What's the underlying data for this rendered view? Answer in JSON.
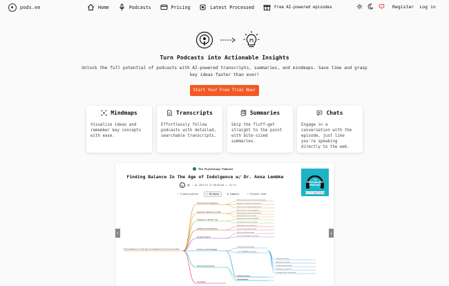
{
  "brand": {
    "name": "pods.ee"
  },
  "nav": {
    "home": "Home",
    "podcasts": "Podcasts",
    "pricing": "Pricing",
    "latest": "Latest Processed",
    "free": "Free AI-powered episodes",
    "register": "Register",
    "login": "Log in"
  },
  "hero": {
    "title": "Turn Podcasts into Actionable Insights",
    "subtitle": "Unlock the full potential of podcasts with AI-powered transcripts, summaries, and mindmaps. Save time and grasp key ideas faster than ever!",
    "cta": "Start Your Free Trial Now!"
  },
  "features": [
    {
      "title": "Mindmaps",
      "icon": "mindmap-icon",
      "desc": "Visualize ideas and remember key concepts with ease."
    },
    {
      "title": "Transcripts",
      "icon": "document-icon",
      "desc": "Effortlessly follow podcasts with detailed, searchable transcripts."
    },
    {
      "title": "Summaries",
      "icon": "stack-icon",
      "desc": "Skip the fluff—get straight to the point with bite-sized summaries."
    },
    {
      "title": "Chats",
      "icon": "chat-icon",
      "desc": "Engage in a conversation with the episode, just like you're speaking directly to the web."
    }
  ],
  "demo": {
    "podcast": "The Psychology Podcast",
    "episode": "Finding Balance In The Age of Indulgence w/ Dr. Anna Lembke",
    "date": "2023-01-12 00:00:00",
    "duration": "01:14",
    "tabs": [
      "Transcription",
      "Mindmap",
      "Summary",
      "Process Chat"
    ],
    "cover": {
      "line1": "THE",
      "line2": "PSYCHOLOGY",
      "line3": "PODCAST",
      "line4": "WITH SCOTT BARRY KAUFMAN"
    },
    "mindmap": {
      "root": "Finding Balance In The Age of Indulgence w/ Dr. Anna Lembke",
      "branches": [
        "Introduction to Dopamine",
        "Dopamine, Pleasure and Pain",
        "Dopamine in Modern Life",
        "Addiction and Dopamine",
        "Societal Impacts",
        "Solutions and Strategies",
        "Personal Experiences",
        "Conclusion"
      ],
      "leaves": [
        "Neurochemical associated with pleasure",
        "Regulates reward and motivation",
        "Balances with opposing processes",
        "Neurons that release dopamine",
        "Relationship to pain and pleasure",
        "Homeostasis after stimulus",
        "Abundance of stimuli available",
        "Increased access to rewards",
        "Dependence on substances",
        "Cycles of craving and relief",
        "Shifts in attention spans",
        "Loss of meaningful connection",
        "Dopamine fasting",
        "Abstinence periods",
        "Embracing discomfort",
        "Mindfulness practices",
        "Examples from clinical work",
        "Personal reflections",
        "Key takeaways"
      ],
      "subnodes": [
        "Self-binding techniques",
        "The DOPAMINE framework",
        "Radical honesty",
        "Reframing pain"
      ]
    }
  },
  "colors": {
    "accent": "#f15a24",
    "cover": "#1eb3c6"
  }
}
